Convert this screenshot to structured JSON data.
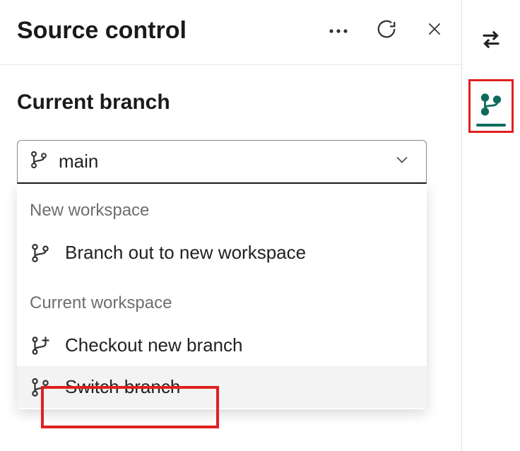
{
  "header": {
    "title": "Source control"
  },
  "section": {
    "label": "Current branch"
  },
  "dropdown": {
    "value": "main",
    "groups": [
      {
        "label": "New workspace",
        "items": [
          {
            "label": "Branch out to new workspace",
            "icon": "branch-icon"
          }
        ]
      },
      {
        "label": "Current workspace",
        "items": [
          {
            "label": "Checkout new branch",
            "icon": "branch-plus-icon"
          },
          {
            "label": "Switch branch",
            "icon": "branch-icon"
          }
        ]
      }
    ]
  },
  "colors": {
    "accent": "#0f6b5c",
    "highlight": "#e02020"
  }
}
